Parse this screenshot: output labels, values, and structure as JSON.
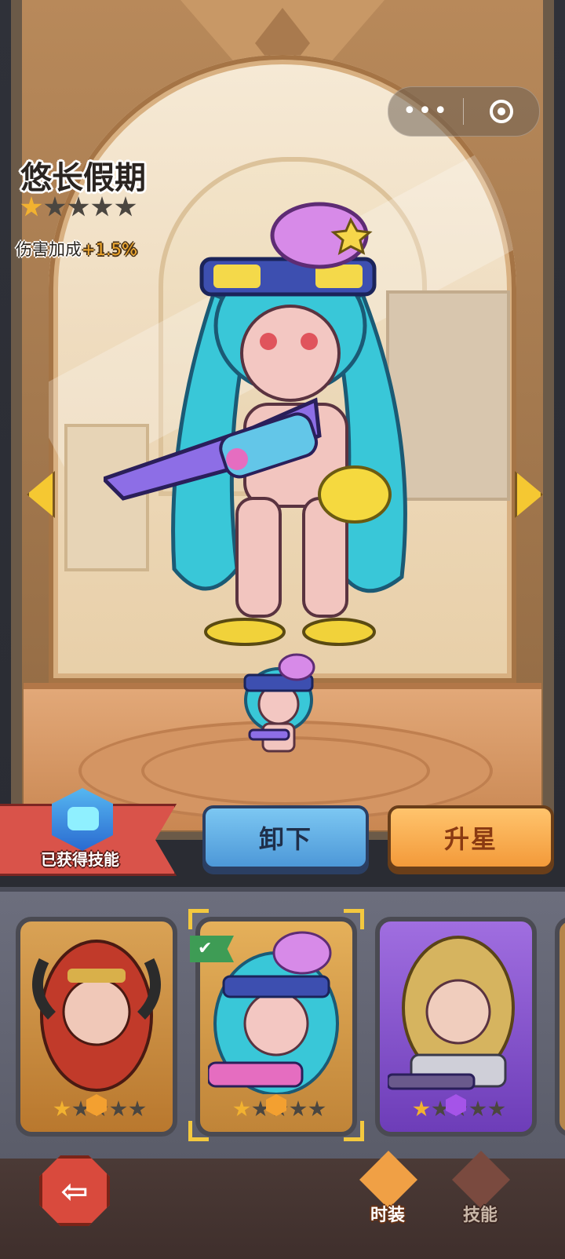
{
  "header": {
    "menu_more": "•••"
  },
  "character": {
    "name": "悠长假期",
    "stars_total": 5,
    "stars_filled": 1,
    "bonus_label": "伤害加成",
    "bonus_value": "+1.5%"
  },
  "actions": {
    "acquired_skill_label": "已获得技能",
    "unequip_label": "卸下",
    "upgrade_star_label": "升星"
  },
  "cards": [
    {
      "id": "red-horned-warrior",
      "stars_filled": 1,
      "stars_total": 5,
      "gem": "orange",
      "selected": false
    },
    {
      "id": "octopus-summer-girl",
      "stars_filled": 1,
      "stars_total": 5,
      "gem": "orange",
      "selected": true,
      "equipped": true
    },
    {
      "id": "blonde-gunner",
      "stars_filled": 1,
      "stars_total": 5,
      "gem": "purple",
      "selected": false
    }
  ],
  "bottom_nav": {
    "fashion_label": "时装",
    "skill_label": "技能"
  },
  "colors": {
    "star_on": "#f2b230",
    "unequip_button": "#5ba9e3",
    "upgrade_button": "#f5a445",
    "skill_ribbon": "#d9534a"
  }
}
